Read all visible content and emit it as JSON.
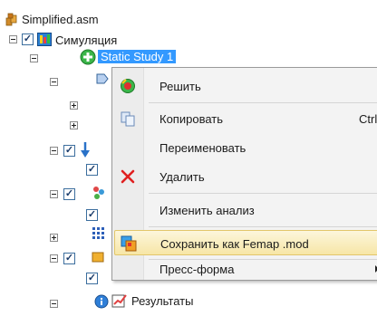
{
  "tree": {
    "root_label": "Simplified.asm",
    "simulation_label": "Симуляция",
    "study_label": "Static Study 1",
    "results_label": "Результаты"
  },
  "context_menu": {
    "items": [
      {
        "label": "Решить",
        "icon": "solve-icon"
      },
      {
        "label": "Копировать",
        "shortcut": "Ctrl+C",
        "icon": "copy-icon"
      },
      {
        "label": "Переименовать"
      },
      {
        "label": "Удалить",
        "icon": "delete-icon"
      },
      {
        "label": "Изменить анализ"
      },
      {
        "label": "Сохранить как Femap .mod",
        "icon": "femap-icon",
        "highlighted": true
      },
      {
        "label": "Пресс-форма",
        "has_submenu": true
      }
    ]
  },
  "colors": {
    "selection": "#3399ff",
    "highlight": "#f7e6a6",
    "delete": "#e02020"
  }
}
